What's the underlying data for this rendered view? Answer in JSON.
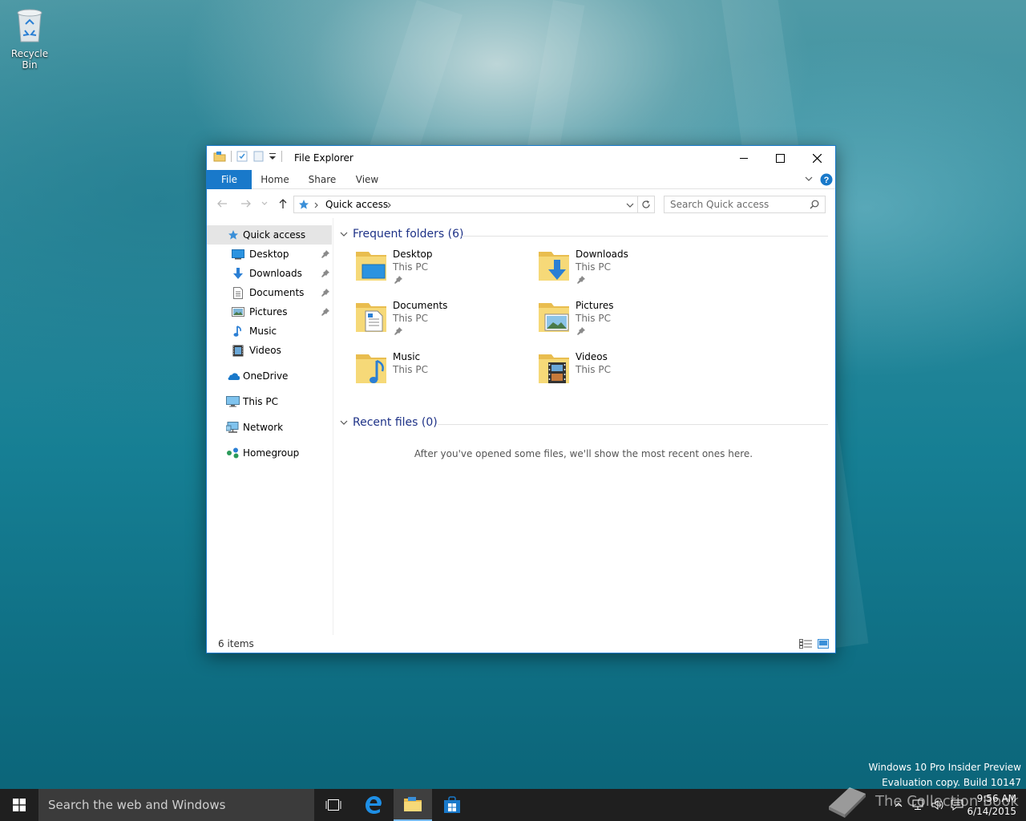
{
  "desktop": {
    "recycle_bin_label": "Recycle Bin",
    "watermark_line1": "Windows 10 Pro Insider Preview",
    "watermark_line2": "Evaluation copy. Build 10147"
  },
  "window": {
    "title": "File Explorer",
    "tabs": {
      "file": "File",
      "home": "Home",
      "share": "Share",
      "view": "View"
    },
    "address": {
      "location": "Quick access"
    },
    "search": {
      "placeholder": "Search Quick access"
    },
    "sidebar": {
      "quick_access": "Quick access",
      "desktop": "Desktop",
      "downloads": "Downloads",
      "documents": "Documents",
      "pictures": "Pictures",
      "music": "Music",
      "videos": "Videos",
      "onedrive": "OneDrive",
      "this_pc": "This PC",
      "network": "Network",
      "homegroup": "Homegroup"
    },
    "frequent": {
      "header": "Frequent folders (6)",
      "folders": [
        {
          "name": "Desktop",
          "location": "This PC"
        },
        {
          "name": "Downloads",
          "location": "This PC"
        },
        {
          "name": "Documents",
          "location": "This PC"
        },
        {
          "name": "Pictures",
          "location": "This PC"
        },
        {
          "name": "Music",
          "location": "This PC"
        },
        {
          "name": "Videos",
          "location": "This PC"
        }
      ]
    },
    "recent": {
      "header": "Recent files (0)",
      "empty_message": "After you've opened some files, we'll show the most recent ones here."
    },
    "status": {
      "count": "6 items"
    }
  },
  "taskbar": {
    "search_text": "Search the web and Windows",
    "time": "9:56 AM",
    "date": "6/14/2015",
    "brand": "The Collection Book"
  },
  "colors": {
    "accent": "#1979ca",
    "group_header": "#1e3287",
    "taskbar": "#1f1f1f",
    "folder": "#f2cd6b"
  }
}
